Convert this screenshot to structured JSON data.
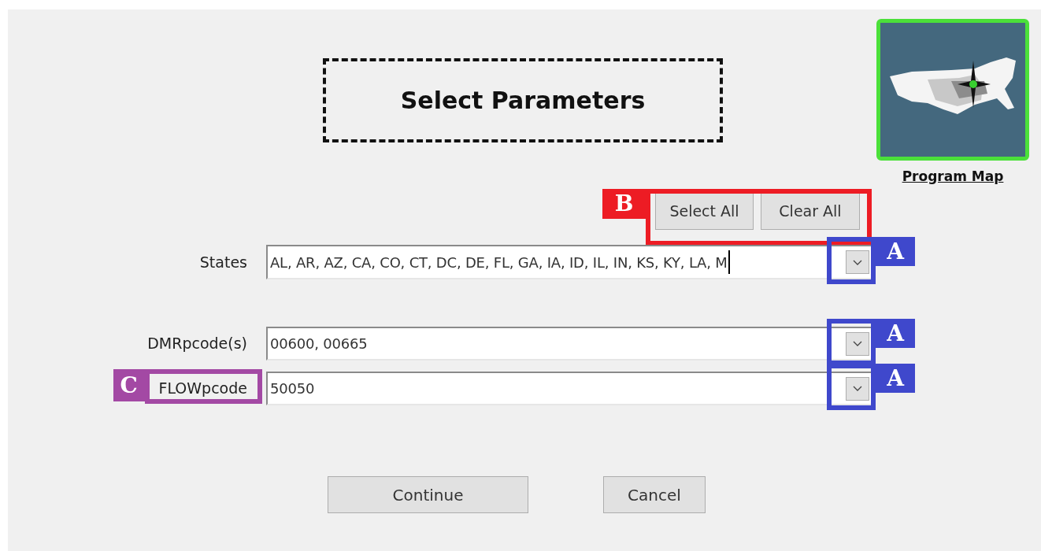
{
  "title": "Select Parameters",
  "program_map": {
    "label": "Program Map"
  },
  "selection_buttons": {
    "buttons": [
      "Select All",
      "Clear All"
    ],
    "annotation": {
      "label": "B",
      "color": "#ed1c24"
    }
  },
  "fields": [
    {
      "label": "States",
      "value": "AL, AR, AZ, CA, CO, CT, DC, DE, FL, GA, IA, ID, IL, IN, KS, KY, LA, M",
      "caret": true,
      "annotation": {
        "label": "A",
        "color": "#3f48cc"
      }
    },
    {
      "label": "DMRpcode(s)",
      "value": "00600, 00665",
      "annotation": {
        "label": "A",
        "color": "#3f48cc"
      }
    },
    {
      "label": "FLOWpcode",
      "value": "50050",
      "annotation": {
        "label": "A",
        "color": "#3f48cc"
      },
      "label_annotation": {
        "label": "C",
        "color": "#a349a4"
      }
    }
  ],
  "actions": [
    "Continue",
    "Cancel"
  ]
}
